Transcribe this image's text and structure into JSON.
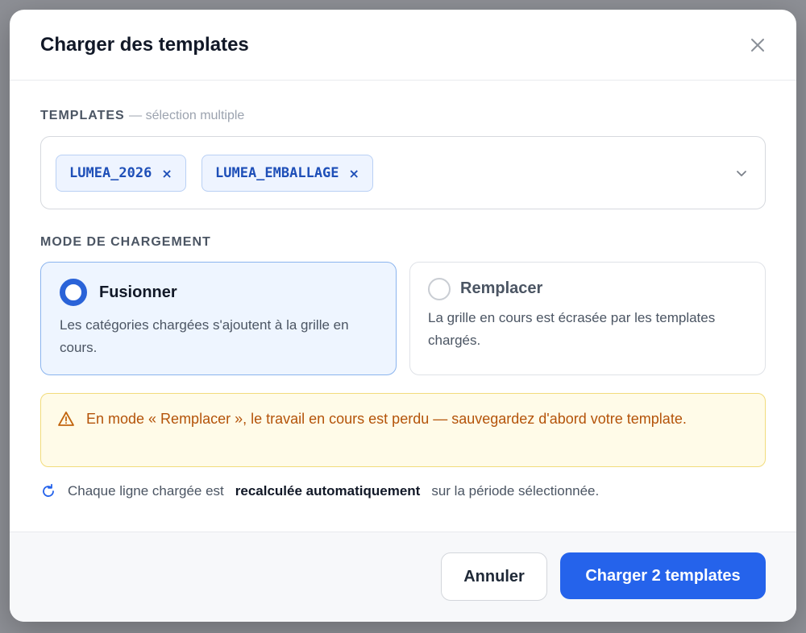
{
  "dialog": {
    "title": "Charger des templates",
    "close_icon": "close-icon"
  },
  "templates": {
    "label": "TEMPLATES",
    "sublabel": "— sélection multiple",
    "chips": [
      {
        "label": "LUMEA_2026",
        "remove": "×"
      },
      {
        "label": "LUMEA_EMBALLAGE",
        "remove": "×"
      }
    ],
    "dropdown_icon": "chevron-down-icon"
  },
  "mode": {
    "label": "MODE DE CHARGEMENT",
    "selected": "merge",
    "options": [
      {
        "id": "merge",
        "title": "Fusionner",
        "description": "Les catégories chargées s'ajoutent à la grille en cours."
      },
      {
        "id": "replace",
        "title": "Remplacer",
        "description": "La grille en cours est écrasée par les templates chargés."
      }
    ]
  },
  "warning": {
    "icon": "warning-icon",
    "text": "En mode « Remplacer », le travail en cours est perdu — sauvegardez d'abord votre template."
  },
  "info": {
    "icon": "refresh-icon",
    "prefix": "Chaque ligne chargée est",
    "emphasis": "recalculée automatiquement",
    "suffix": "sur la période sélectionnée."
  },
  "footer": {
    "cancel_label": "Annuler",
    "submit_label": "Charger 2 templates"
  },
  "colors": {
    "accent": "#2563eb",
    "chip_text": "#1e4fb8",
    "warning_text": "#b45309",
    "warning_bg": "#fffbe8"
  }
}
